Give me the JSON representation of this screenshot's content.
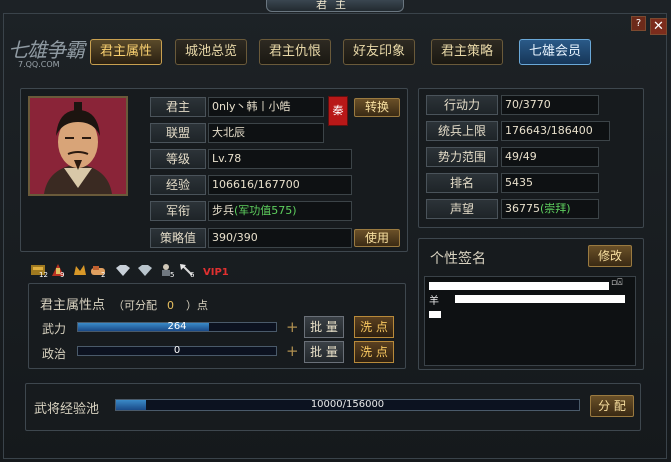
{
  "window": {
    "title": "君主",
    "help": "?",
    "close": "✕"
  },
  "logo": {
    "big": "七雄争霸",
    "small": "7.QQ.COM"
  },
  "tabs": [
    {
      "label": "君主属性",
      "active": true
    },
    {
      "label": "城池总览"
    },
    {
      "label": "君主仇恨"
    },
    {
      "label": "好友印象"
    },
    {
      "label": "君主策略"
    },
    {
      "label": "七雄会员",
      "vip": true
    }
  ],
  "profile": {
    "lord_label": "君主",
    "lord_value": "0nly丶韩丨小皓",
    "seal": "秦",
    "switch_button": "转换",
    "alliance_label": "联盟",
    "alliance_value": "大北辰",
    "level_label": "等级",
    "level_value": "Lv.78",
    "exp_label": "经验",
    "exp_value": "106616/167700",
    "rank_label": "军衔",
    "rank_value": "步兵",
    "rank_extra": "(军功值575)",
    "strategy_label": "策略值",
    "strategy_value": "390/390",
    "use_button": "使用"
  },
  "stats": {
    "action_label": "行动力",
    "action_value": "70/3770",
    "troops_label": "统兵上限",
    "troops_value": "176643/186400",
    "influence_label": "势力范围",
    "influence_value": "49/49",
    "ranking_label": "排名",
    "ranking_value": "5435",
    "prestige_label": "声望",
    "prestige_value": "36775",
    "prestige_extra": "(崇拜)"
  },
  "badges": {
    "nums": [
      "12",
      "9",
      "2",
      "5",
      "6"
    ],
    "vip": "VIP1"
  },
  "attributes": {
    "title": "君主属性点",
    "allocatable_open": "（可分配",
    "allocatable_value": "0",
    "allocatable_close": "）点",
    "rows": [
      {
        "name": "武力",
        "value": "264",
        "fill": 0.6,
        "batch": "批 量",
        "wash": "洗 点"
      },
      {
        "name": "政治",
        "value": "0",
        "fill": 0.0,
        "batch": "批 量",
        "wash": "洗 点"
      }
    ]
  },
  "signature": {
    "title": "个性签名",
    "edit_button": "修改",
    "line2_prefix": "羊"
  },
  "exp_pool": {
    "label": "武将经验池",
    "value": "10000/156000",
    "fill": 0.064,
    "distribute_button": "分 配"
  }
}
